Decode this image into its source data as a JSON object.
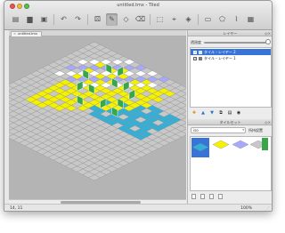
{
  "window": {
    "title": "untitled.tmx - Tiled"
  },
  "toolbar": {
    "buttons": [
      {
        "name": "new-map-button",
        "icon": "new-map-icon",
        "glyph": "▤"
      },
      {
        "name": "open-map-button",
        "icon": "open-folder-icon",
        "glyph": "▆"
      },
      {
        "name": "save-map-button",
        "icon": "save-icon",
        "glyph": "▣"
      },
      {
        "name": "undo-button",
        "icon": "undo-icon",
        "glyph": "↶"
      },
      {
        "name": "redo-button",
        "icon": "redo-icon",
        "glyph": "↷"
      },
      {
        "name": "random-mode-button",
        "icon": "dice-icon",
        "glyph": "⚄"
      },
      {
        "name": "stamp-brush-button",
        "icon": "stamp-icon",
        "glyph": "✎"
      },
      {
        "name": "bucket-fill-button",
        "icon": "bucket-fill-icon",
        "glyph": "◇"
      },
      {
        "name": "eraser-button",
        "icon": "eraser-icon",
        "glyph": "⌫"
      },
      {
        "name": "rect-select-button",
        "icon": "select-rect-icon",
        "glyph": "⬚"
      },
      {
        "name": "magic-wand-button",
        "icon": "magic-wand-icon",
        "glyph": "⌖"
      },
      {
        "name": "select-same-tile-button",
        "icon": "select-same-icon",
        "glyph": "◈"
      },
      {
        "name": "insert-object-button",
        "icon": "object-icon",
        "glyph": "▭"
      },
      {
        "name": "insert-polygon-button",
        "icon": "polygon-icon",
        "glyph": "⬠"
      },
      {
        "name": "insert-polyline-button",
        "icon": "polyline-icon",
        "glyph": "⌇"
      },
      {
        "name": "insert-tile-button",
        "icon": "tile-icon",
        "glyph": "▦"
      }
    ],
    "active_index": 6
  },
  "tab": {
    "label": "untitled.tmx",
    "close": "×"
  },
  "layers_panel": {
    "title": "レイヤー",
    "opacity_label": "透過度",
    "opacity": 1.0,
    "layers": [
      {
        "label": "タイル・レイヤー 2",
        "visible": true,
        "selected": true
      },
      {
        "label": "タイル・レイヤー 1",
        "visible": true,
        "selected": false
      }
    ]
  },
  "tileset_panel": {
    "title": "タイルセット",
    "selected_tileset": "iso",
    "options_button": "所持設置"
  },
  "status": {
    "coords": "14, 11",
    "zoom": "100%"
  },
  "colors": {
    "canvas_bg": "#b4b4b4",
    "grid_tile": "#c8c8c8",
    "yellow_tile": "#f4f200",
    "blue_tile": "#33b0d8",
    "checker_a": "#a8a8ff",
    "checker_b": "#ffffff",
    "wall_green": "#3aa64a",
    "selection_blue": "#3874d8"
  }
}
